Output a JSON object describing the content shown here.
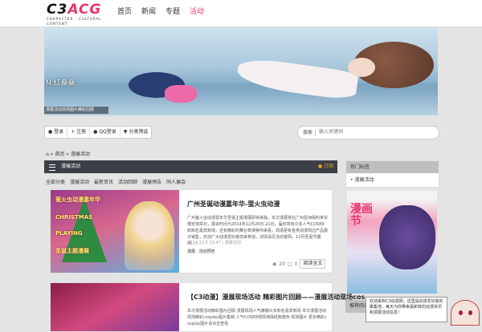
{
  "logo": {
    "text_main": "C3",
    "text_accent": "ACG",
    "tagline": "CHARACTER · CULTURAL · CONTENT"
  },
  "nav": {
    "items": [
      "首页",
      "新闻",
      "专题",
      "活动"
    ],
    "active": 3
  },
  "banner": {
    "caption": "N.红桑桑",
    "strip": "漫展活动现场图片精彩回顾"
  },
  "toolbar": {
    "items": [
      {
        "icon": "user-icon",
        "label": "登录"
      },
      {
        "icon": "plus-icon",
        "label": "注册"
      },
      {
        "icon": "qq-icon",
        "label": "QQ登录"
      },
      {
        "icon": "filter-icon",
        "label": "分类筛选"
      }
    ]
  },
  "search": {
    "label": "搜索",
    "placeholder": "输入关键词"
  },
  "breadcrumb": {
    "home_icon": "home-icon",
    "items": [
      "首页",
      "漫展活动"
    ]
  },
  "section": {
    "title": "漫展活动",
    "rss_label": "订阅"
  },
  "subnav": {
    "items": [
      "全部分类",
      "漫展活动",
      "最新资讯",
      "活动回顾",
      "漫展预告",
      "同人展会"
    ]
  },
  "posts": [
    {
      "title": "广州圣诞动漫嘉年华-萤火虫动漫",
      "thumb_text": [
        "萤火虫动漫嘉年华",
        "CHRISTMAS",
        "PLAYING",
        "圣诞主题漫展"
      ],
      "excerpt": "广州萤火虫动漫嘉年华圣诞主题漫展即将来临，本次漫展将在广州琶洲保利世贸博览馆举办，展会时间为2014年12月20日-21日，届时将有众多人气COSER和知名嘉宾到场，还有精彩的舞台表演等你来看，现场更有各类动漫周边产品展示销售，欢迎广大动漫爱好者前来参加，详情请见活动官网，12月圣诞节期间……",
      "date": "2014-12-5 13:47",
      "category": "漫展活动",
      "tags": "漫展 · 活动预告",
      "views": "20",
      "comments": "0",
      "more": "阅读全文"
    },
    {
      "title": "【C3动漫】漫展现场活动 精彩图片回顾——漫展活动现场cos",
      "excerpt": "本次漫展活动精彩图片回顾 漫展现场人气爆棚众多知名嘉宾到场 本次漫展活动现场精彩cosplay图片集锦 人气COSER倾情演绎经典角色 现场图片 更多精彩cosplay图片请点击查看"
    }
  ],
  "sidebar": {
    "box_title": "热门标签",
    "box_item": "漫展活动",
    "poster_title": "漫画节",
    "box2_title": "推荐阅读"
  },
  "popup": {
    "text": "欢迎来到C3动漫网，这里是动漫爱好者的聚集地，每天为你带来最新鲜的动漫资讯和漫展活动信息！"
  }
}
